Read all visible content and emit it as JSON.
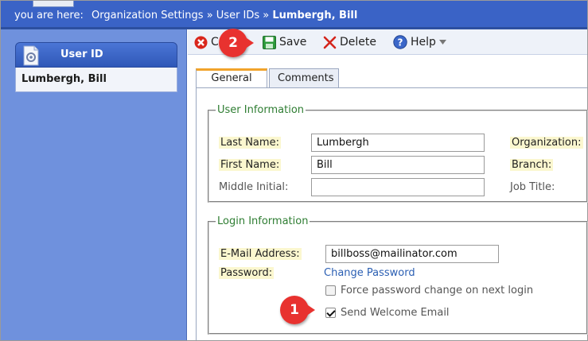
{
  "breadcrumb": {
    "prefix": "you are here:",
    "path": "Organization Settings » User IDs »",
    "current": "Lumbergh, Bill"
  },
  "sidebar": {
    "header": "User ID",
    "selected_item": "Lumbergh, Bill"
  },
  "toolbar": {
    "close_label": "C",
    "save_label": "Save",
    "delete_label": "Delete",
    "help_label": "Help"
  },
  "callouts": {
    "one": "1",
    "two": "2"
  },
  "tabs": {
    "general": "General",
    "comments": "Comments"
  },
  "user_info": {
    "legend": "User Information",
    "last_name_label": "Last Name:",
    "last_name_value": "Lumbergh",
    "first_name_label": "First Name:",
    "first_name_value": "Bill",
    "middle_initial_label": "Middle Initial:",
    "middle_initial_value": "",
    "organization_label": "Organization:",
    "branch_label": "Branch:",
    "job_title_label": "Job Title:"
  },
  "login_info": {
    "legend": "Login Information",
    "email_label": "E-Mail Address:",
    "email_value": "billboss@mailinator.com",
    "password_label": "Password:",
    "change_password_link": "Change Password",
    "force_change_label": "Force password change on next login",
    "force_change_checked": false,
    "welcome_email_label": "Send Welcome Email",
    "welcome_email_checked": true
  },
  "colors": {
    "header_blue": "#3a63c6",
    "sidebar_blue": "#6f91dd",
    "callout_red": "#e8322f",
    "legend_green": "#2e7d32",
    "required_highlight": "#fbf7cf",
    "link_blue": "#2b5fb3"
  }
}
